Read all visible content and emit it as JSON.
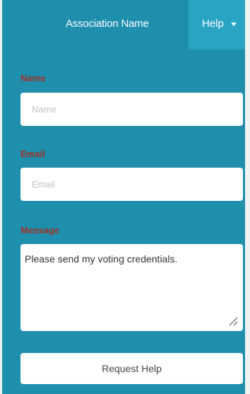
{
  "header": {
    "brand": "Association Name",
    "help_menu": {
      "label": "Help",
      "icon": "caret-down-icon"
    }
  },
  "form": {
    "name": {
      "label": "Name",
      "placeholder": "Name",
      "value": ""
    },
    "email": {
      "label": "Email",
      "placeholder": "Email",
      "value": ""
    },
    "message": {
      "label": "Message",
      "value": "Please send my voting credentials."
    },
    "submit_label": "Request Help"
  },
  "colors": {
    "background": "#1e8fad",
    "help_menu_background": "#2aa4c4",
    "label_text": "#9f2f24",
    "field_background": "#ffffff"
  }
}
